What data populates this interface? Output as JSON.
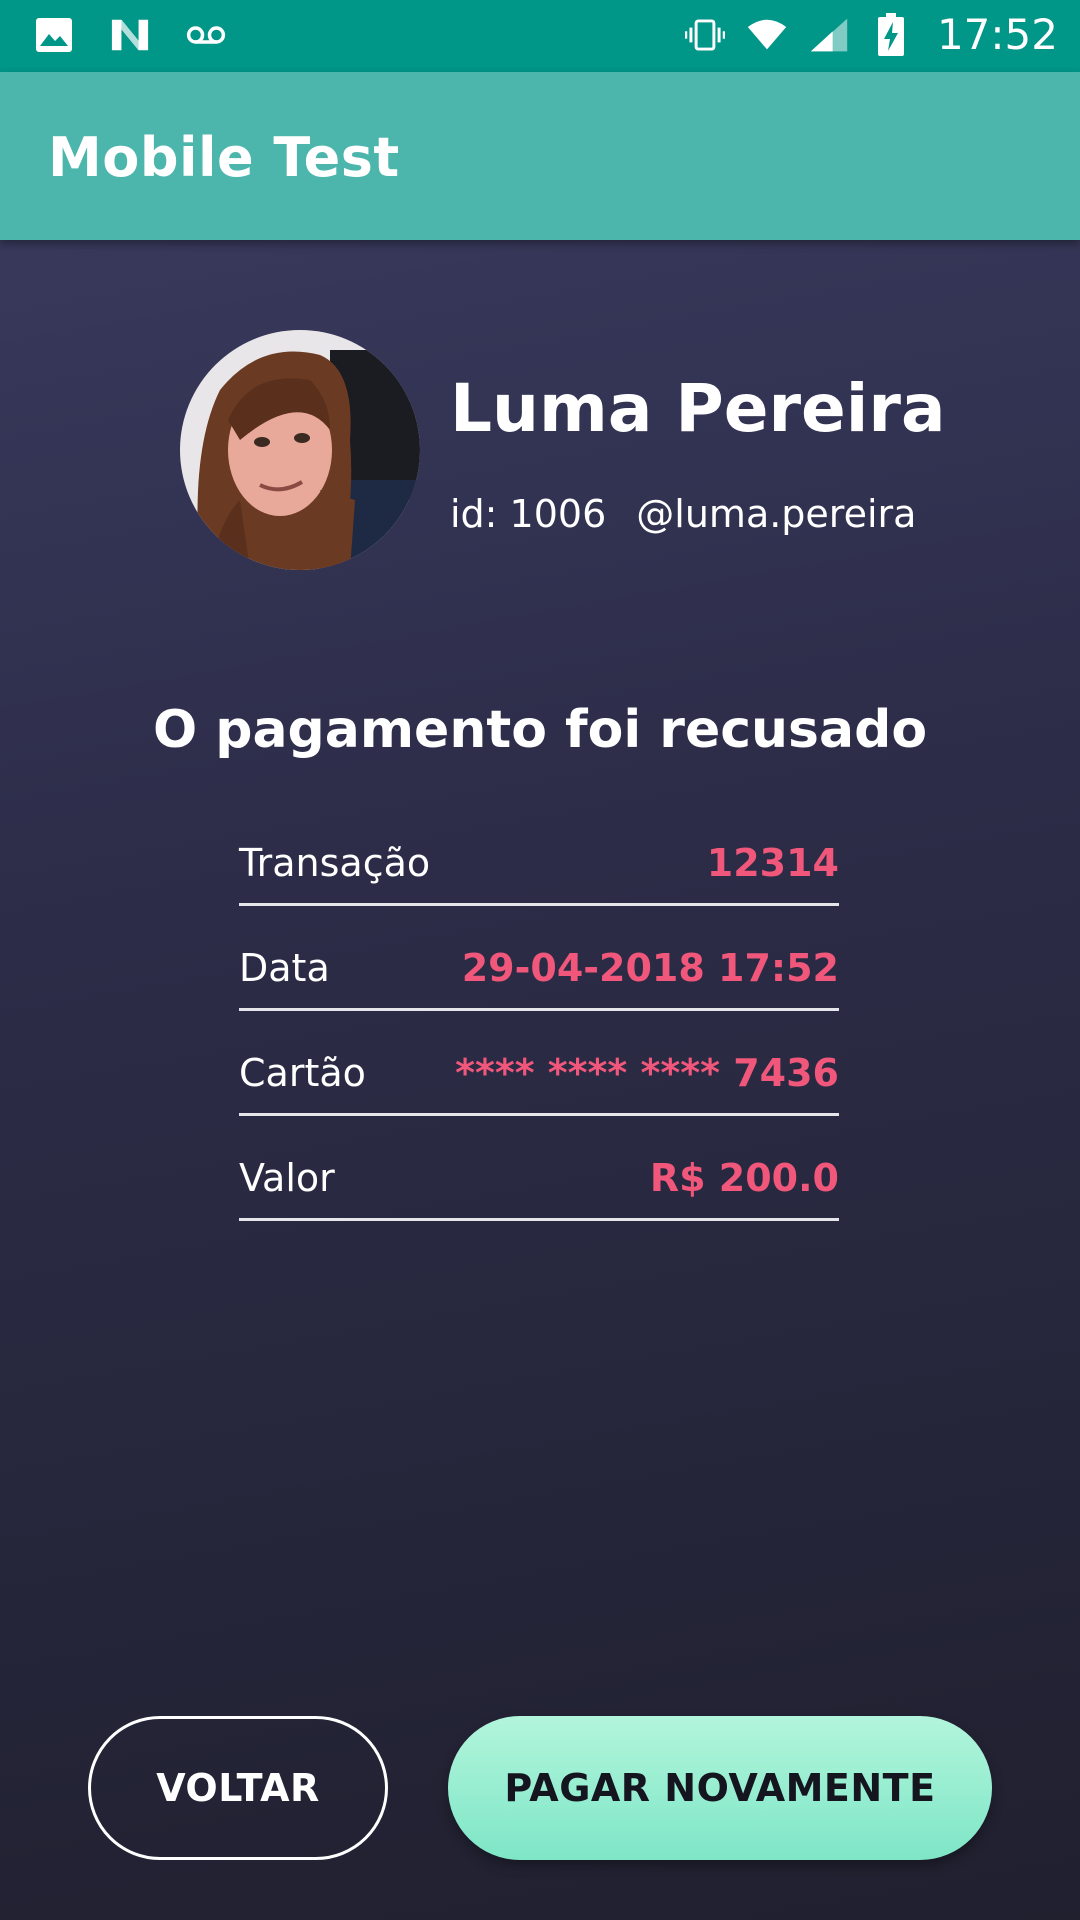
{
  "status_bar": {
    "time": "17:52",
    "icons": [
      "image-icon",
      "n-logo-icon",
      "voicemail-icon",
      "vibrate-icon",
      "wifi-icon",
      "signal-icon",
      "battery-charging-icon"
    ]
  },
  "app_bar": {
    "title": "Mobile Test"
  },
  "profile": {
    "name": "Luma Pereira",
    "id_text": "id: 1006",
    "username": "@luma.pereira"
  },
  "result": {
    "title": "O pagamento foi recusado"
  },
  "details": [
    {
      "label": "Transação",
      "value": "12314"
    },
    {
      "label": "Data",
      "value": "29-04-2018 17:52"
    },
    {
      "label": "Cartão",
      "value": "**** **** **** 7436"
    },
    {
      "label": "Valor",
      "value": "R$ 200.0"
    }
  ],
  "buttons": {
    "back": "VOLTAR",
    "retry": "PAGAR NOVAMENTE"
  },
  "colors": {
    "status_bar": "#009688",
    "app_bar": "#4db6ac",
    "accent_value": "#f0577a",
    "button_primary": "#8eeccd"
  }
}
